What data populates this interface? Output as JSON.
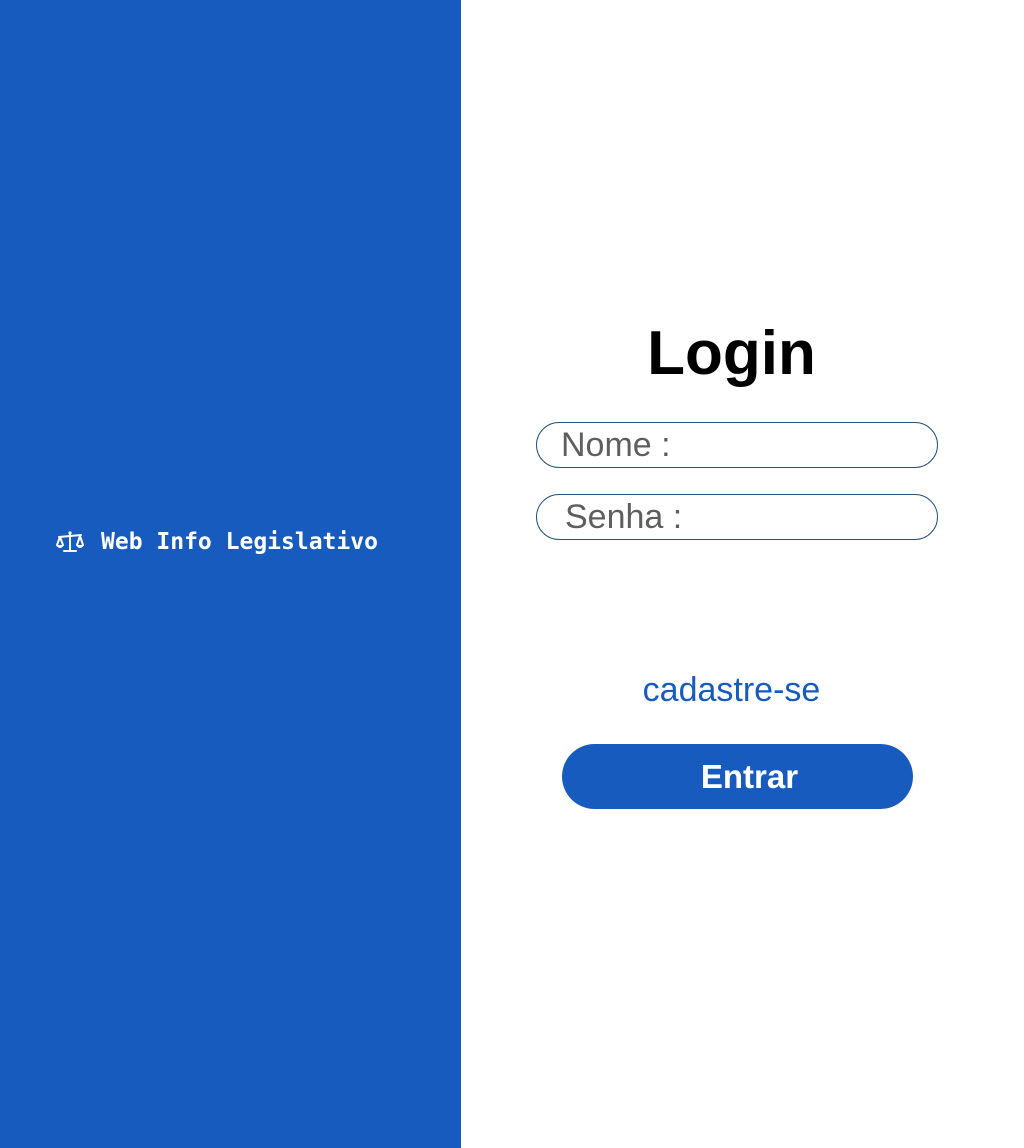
{
  "brand": {
    "icon": "scale-icon",
    "name": "Web Info Legislativo"
  },
  "login": {
    "title": "Login",
    "name_placeholder": "Nome :",
    "password_placeholder": "Senha :",
    "signup_link": "cadastre-se",
    "submit_label": "Entrar"
  },
  "colors": {
    "brand_blue": "#175bbf",
    "field_border": "#23527c",
    "placeholder_gray": "#5e5e5e"
  }
}
